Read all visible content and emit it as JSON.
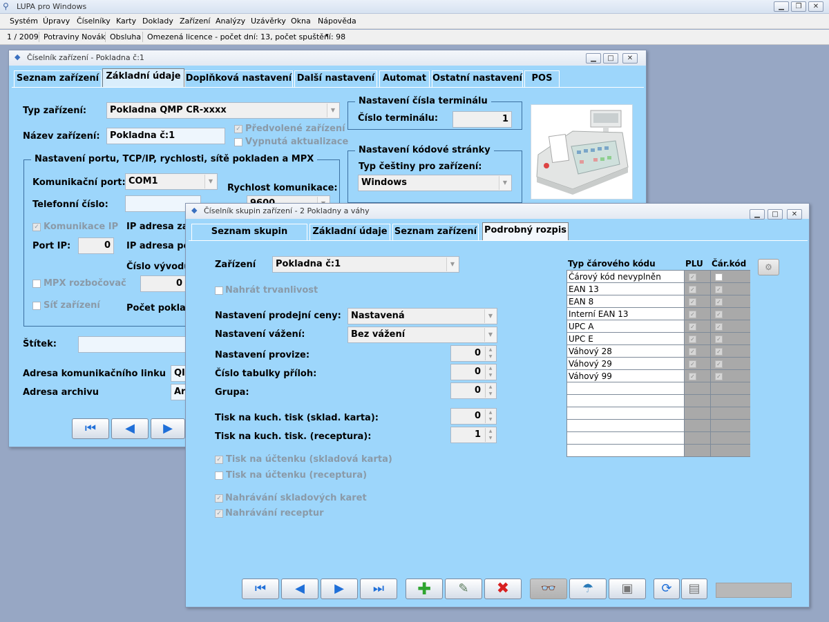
{
  "app": {
    "title": "LUPA pro Windows"
  },
  "menu": [
    "Systém",
    "Úpravy",
    "Číselníky",
    "Karty",
    "Doklady",
    "Zařízení",
    "Analýzy",
    "Uzávěrky",
    "Okna",
    "Nápověda"
  ],
  "status": {
    "period": "1 / 2009",
    "company": "Potraviny Novák",
    "user": "Obsluha",
    "licence": "Omezená licence - počet dní: 13, počet spuštění: 98"
  },
  "win1": {
    "title": "Číselník zařízení - Pokladna č:1",
    "tabs": [
      "Seznam zařízení",
      "Základní údaje",
      "Doplňková nastavení",
      "Další nastavení",
      "Automat",
      "Ostatní nastavení",
      "POS"
    ],
    "typ_label": "Typ zařízení:",
    "typ_value": "Pokladna QMP CR-xxxx",
    "nazev_label": "Název zařízení:",
    "nazev_value": "Pokladna č:1",
    "predvolene": "Předvolené zařízení",
    "vypnuta": "Vypnutá aktualizace",
    "group_port": "Nastavení portu, TCP/IP, rychlosti, sítě pokladen a MPX",
    "kom_port_label": "Komunikační port:",
    "kom_port_value": "COM1",
    "rychlost_label": "Rychlost komunikace:",
    "rychlost_value": "9600",
    "telefon_label": "Telefonní číslo:",
    "komunikace_ip": "Komunikace IP",
    "ip_adresa_1": "IP adresa zař",
    "port_ip_label": "Port IP:",
    "port_ip_value": "0",
    "ip_adresa_2": "IP adresa po",
    "cislo_vyvodu": "Číslo vývodu",
    "mpx": "MPX rozbočovač",
    "mpx_value": "0",
    "sit": "Síť zařízení",
    "pocet_pokladen": "Počet poklad",
    "stitek_label": "Štítek:",
    "adresa_linku": "Adresa komunikačního linku",
    "adresa_linku_value": "QI",
    "adresa_archivu": "Adresa archivu",
    "adresa_archivu_value": "Ar",
    "group_terminal": "Nastavení čísla terminálu",
    "terminal_label": "Číslo terminálu:",
    "terminal_value": "1",
    "group_kodova": "Nastavení kódové stránky",
    "cestina_label": "Typ češtiny pro zařízení:",
    "cestina_value": "Windows"
  },
  "win2": {
    "title": "Číselník skupin zařízení - 2 Pokladny a váhy",
    "tabs": [
      "Seznam skupin zařízení",
      "Základní údaje",
      "Seznam zařízení",
      "Podrobný rozpis"
    ],
    "zarizeni_label": "Zařízení",
    "zarizeni_value": "Pokladna č:1",
    "nahrat_trvanlivost": "Nahrát trvanlivost",
    "prodejni_label": "Nastavení prodejní ceny:",
    "prodejni_value": "Nastavená",
    "vazeni_label": "Nastavení vážení:",
    "vazeni_value": "Bez vážení",
    "provize_label": "Nastavení provize:",
    "provize_value": "0",
    "tabulky_label": "Číslo tabulky příloh:",
    "tabulky_value": "0",
    "grupa_label": "Grupa:",
    "grupa_value": "0",
    "kuch_karta_label": "Tisk na kuch. tisk (sklad. karta):",
    "kuch_karta_value": "0",
    "kuch_receptura_label": "Tisk na kuch. tisk. (receptura):",
    "kuch_receptura_value": "1",
    "uctenka_karta": "Tisk na účtenku (skladová karta)",
    "uctenka_receptura": "Tisk na účtenku (receptura)",
    "nahravani_karet": "Nahrávání skladových karet",
    "nahravani_receptur": "Nahrávání receptur",
    "table": {
      "headers": [
        "Typ čárového kódu",
        "PLU",
        "Čár.kód"
      ],
      "rows": [
        "Čárový kód nevyplněn",
        "EAN 13",
        "EAN 8",
        "Interní EAN 13",
        "UPC A",
        "UPC E",
        "Váhový 28",
        "Váhový 29",
        "Váhový 99"
      ]
    }
  }
}
